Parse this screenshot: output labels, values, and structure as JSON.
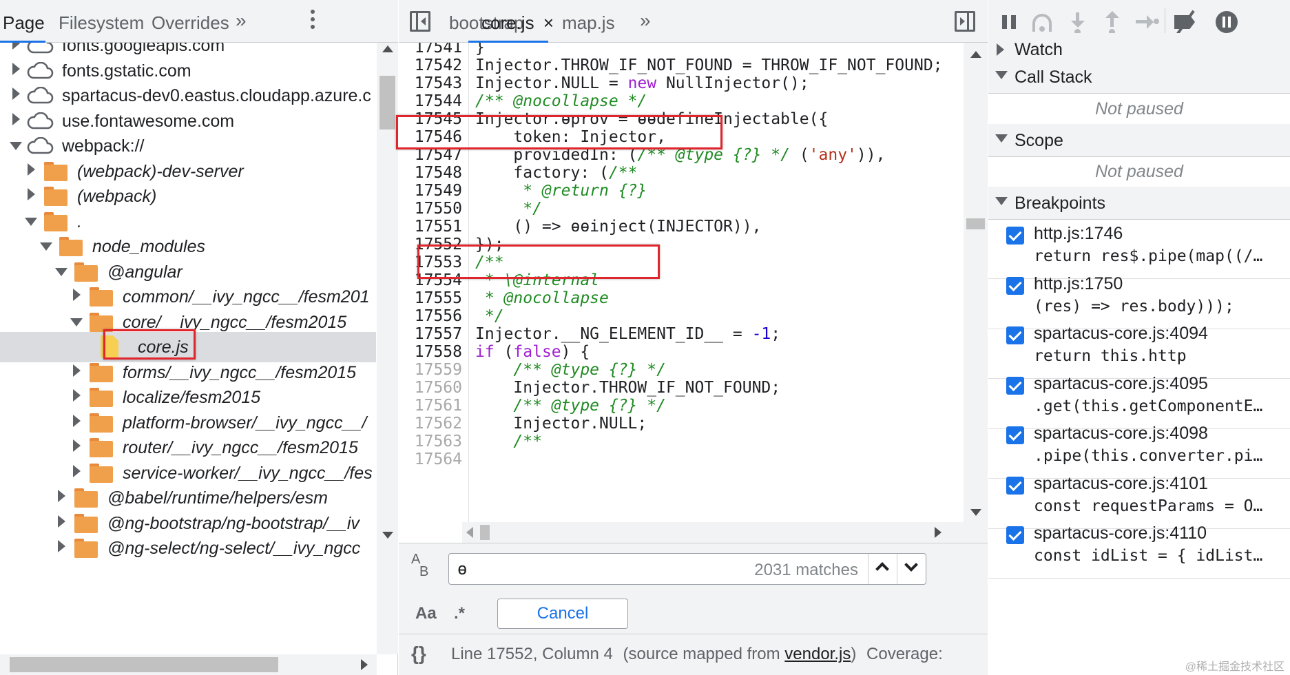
{
  "navigator": {
    "tabs": [
      {
        "label": "Page",
        "active": true
      },
      {
        "label": "Filesystem",
        "active": false
      },
      {
        "label": "Overrides",
        "active": false
      }
    ],
    "more_tabs": "»",
    "tree": [
      {
        "label": "fonts.googleapis.com",
        "kind": "cloud",
        "state": "collapsed",
        "italic": false
      },
      {
        "label": "fonts.gstatic.com",
        "kind": "cloud",
        "state": "collapsed",
        "italic": false
      },
      {
        "label": "spartacus-dev0.eastus.cloudapp.azure.c",
        "kind": "cloud",
        "state": "collapsed",
        "italic": false
      },
      {
        "label": "use.fontawesome.com",
        "kind": "cloud",
        "state": "collapsed",
        "italic": false
      },
      {
        "label": "webpack://",
        "kind": "cloud",
        "state": "expanded",
        "italic": false
      },
      {
        "label": "(webpack)-dev-server",
        "kind": "folder",
        "state": "collapsed",
        "italic": true
      },
      {
        "label": "(webpack)",
        "kind": "folder",
        "state": "collapsed",
        "italic": true
      },
      {
        "label": ".",
        "kind": "folder",
        "state": "expanded",
        "italic": true
      },
      {
        "label": "node_modules",
        "kind": "folder",
        "state": "expanded",
        "italic": true
      },
      {
        "label": "@angular",
        "kind": "folder",
        "state": "expanded",
        "italic": true
      },
      {
        "label": "common/__ivy_ngcc__/fesm201",
        "kind": "folder",
        "state": "collapsed",
        "italic": true
      },
      {
        "label": "core/__ivy_ngcc__/fesm2015",
        "kind": "folder",
        "state": "expanded",
        "italic": true
      },
      {
        "label": "core.js",
        "kind": "file",
        "state": "none",
        "italic": true,
        "selected": true
      },
      {
        "label": "forms/__ivy_ngcc__/fesm2015",
        "kind": "folder",
        "state": "collapsed",
        "italic": true
      },
      {
        "label": "localize/fesm2015",
        "kind": "folder",
        "state": "collapsed",
        "italic": true
      },
      {
        "label": "platform-browser/__ivy_ngcc__/",
        "kind": "folder",
        "state": "collapsed",
        "italic": true
      },
      {
        "label": "router/__ivy_ngcc__/fesm2015",
        "kind": "folder",
        "state": "collapsed",
        "italic": true
      },
      {
        "label": "service-worker/__ivy_ngcc__/fes",
        "kind": "folder",
        "state": "collapsed",
        "italic": true
      },
      {
        "label": "@babel/runtime/helpers/esm",
        "kind": "folder",
        "state": "collapsed",
        "italic": true
      },
      {
        "label": "@ng-bootstrap/ng-bootstrap/__iv",
        "kind": "folder",
        "state": "collapsed",
        "italic": true
      },
      {
        "label": "@ng-select/ng-select/__ivy_ngcc",
        "kind": "folder",
        "state": "collapsed",
        "italic": true
      }
    ]
  },
  "editor": {
    "tabs": [
      {
        "label": "bootstrap",
        "active": false,
        "closable": false
      },
      {
        "label": "core.js",
        "active": true,
        "closable": true
      },
      {
        "label": "map.js",
        "active": false,
        "closable": false
      }
    ],
    "more_tabs": "»",
    "close_glyph": "×",
    "lines": [
      {
        "n": "17541",
        "dim": false,
        "html": "}"
      },
      {
        "n": "17542",
        "dim": false,
        "html": "Injector.THROW_IF_NOT_FOUND = THROW_IF_NOT_FOUND;"
      },
      {
        "n": "17543",
        "dim": false,
        "html": "Injector.NULL = <span class=\"kw\">new</span> NullInjector();"
      },
      {
        "n": "17544",
        "dim": false,
        "html": "<span class=\"cm\">/** @nocollapse */</span>"
      },
      {
        "n": "17545",
        "dim": false,
        "html": "Injector.ɵprov = ɵɵdefineInjectable({"
      },
      {
        "n": "17546",
        "dim": false,
        "html": "    token: Injector,"
      },
      {
        "n": "17547",
        "dim": false,
        "html": "    providedIn: (<span class=\"cm\">/** @type {?} */</span> (<span class=\"str\">'any'</span>)),"
      },
      {
        "n": "17548",
        "dim": false,
        "html": "    factory: (<span class=\"cm\">/**</span>"
      },
      {
        "n": "17549",
        "dim": false,
        "html": "<span class=\"cm\">     * @return {?}</span>"
      },
      {
        "n": "17550",
        "dim": false,
        "html": "<span class=\"cm\">     */</span>"
      },
      {
        "n": "17551",
        "dim": false,
        "html": "    () =&gt; ɵɵinject(INJECTOR)),"
      },
      {
        "n": "17552",
        "dim": false,
        "html": "});"
      },
      {
        "n": "17553",
        "dim": false,
        "html": "<span class=\"cm\">/**</span>"
      },
      {
        "n": "17554",
        "dim": false,
        "html": "<span class=\"cm\"> * \\@internal</span>"
      },
      {
        "n": "17555",
        "dim": false,
        "html": "<span class=\"cm\"> * @nocollapse</span>"
      },
      {
        "n": "17556",
        "dim": false,
        "html": "<span class=\"cm\"> */</span>"
      },
      {
        "n": "17557",
        "dim": false,
        "html": "Injector.__NG_ELEMENT_ID__ = <span class=\"num\">-1</span>;"
      },
      {
        "n": "17558",
        "dim": false,
        "html": "<span class=\"kw\">if</span> (<span class=\"kw\">false</span>) {"
      },
      {
        "n": "17559",
        "dim": true,
        "html": "    <span class=\"cm\">/** @type {?} */</span>"
      },
      {
        "n": "17560",
        "dim": true,
        "html": "    Injector.THROW_IF_NOT_FOUND;"
      },
      {
        "n": "17561",
        "dim": true,
        "html": "    <span class=\"cm\">/** @type {?} */</span>"
      },
      {
        "n": "17562",
        "dim": true,
        "html": "    Injector.NULL;"
      },
      {
        "n": "17563",
        "dim": true,
        "html": "    <span class=\"cm\">/**</span>"
      },
      {
        "n": "17564",
        "dim": true,
        "html": ""
      }
    ],
    "find": {
      "value": "ɵ",
      "count": "2031 matches",
      "case_label": "Aa",
      "regex_label": ".*",
      "cancel_label": "Cancel"
    },
    "status": {
      "braces": "{}",
      "position": "Line 17552, Column 4",
      "mapped_prefix": "(source mapped from ",
      "mapped_file": "vendor.js",
      "mapped_suffix": ")",
      "coverage": "Coverage:"
    }
  },
  "debugger": {
    "sections": {
      "watch": "Watch",
      "call_stack": "Call Stack",
      "scope": "Scope",
      "breakpoints": "Breakpoints"
    },
    "not_paused": "Not paused",
    "breakpoints": [
      {
        "location": "http.js:1746",
        "code": "return res$.pipe(map((/…",
        "checked": true
      },
      {
        "location": "http.js:1750",
        "code": "(res) => res.body)));",
        "checked": true
      },
      {
        "location": "spartacus-core.js:4094",
        "code": "return this.http",
        "checked": true
      },
      {
        "location": "spartacus-core.js:4095",
        "code": ".get(this.getComponentE…",
        "checked": true
      },
      {
        "location": "spartacus-core.js:4098",
        "code": ".pipe(this.converter.pi…",
        "checked": true
      },
      {
        "location": "spartacus-core.js:4101",
        "code": "const requestParams = O…",
        "checked": true
      },
      {
        "location": "spartacus-core.js:4110",
        "code": "const idList = { idList…",
        "checked": true
      }
    ],
    "watermark": "@稀土掘金技术社区"
  },
  "colors": {
    "accent": "#1a73e8",
    "highlight_box": "#e0262c",
    "folder": "#f0a04b",
    "comment": "#1f8b22",
    "keyword": "#a020d0",
    "string": "#b5301b"
  }
}
